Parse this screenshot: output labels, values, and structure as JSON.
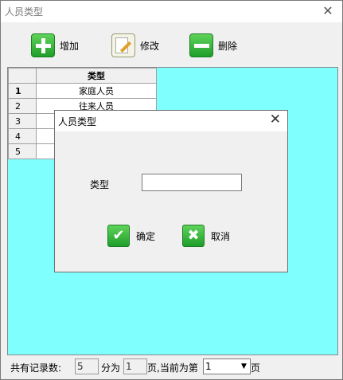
{
  "window": {
    "title": "人员类型",
    "close_glyph": "✕"
  },
  "toolbar": {
    "add": {
      "label": "增加",
      "icon": "plus-icon"
    },
    "edit": {
      "label": "修改",
      "icon": "edit-icon"
    },
    "delete": {
      "label": "删除",
      "icon": "minus-icon"
    }
  },
  "grid": {
    "header": "类型",
    "rows": [
      {
        "num": "1",
        "value": "家庭人员"
      },
      {
        "num": "2",
        "value": "往来人员"
      },
      {
        "num": "3",
        "value": ""
      },
      {
        "num": "4",
        "value": ""
      },
      {
        "num": "5",
        "value": ""
      }
    ],
    "background_color": "#80ffff"
  },
  "dialog": {
    "title": "人员类型",
    "close_glyph": "✕",
    "field_label": "类型",
    "field_value": "",
    "ok_label": "确定",
    "cancel_label": "取消"
  },
  "status": {
    "total_label": "共有记录数:",
    "total_value": "5",
    "pages_label": "分为",
    "pages_value": "1",
    "current_label": "页,当前为第",
    "current_value": "1",
    "page_suffix": "页"
  }
}
